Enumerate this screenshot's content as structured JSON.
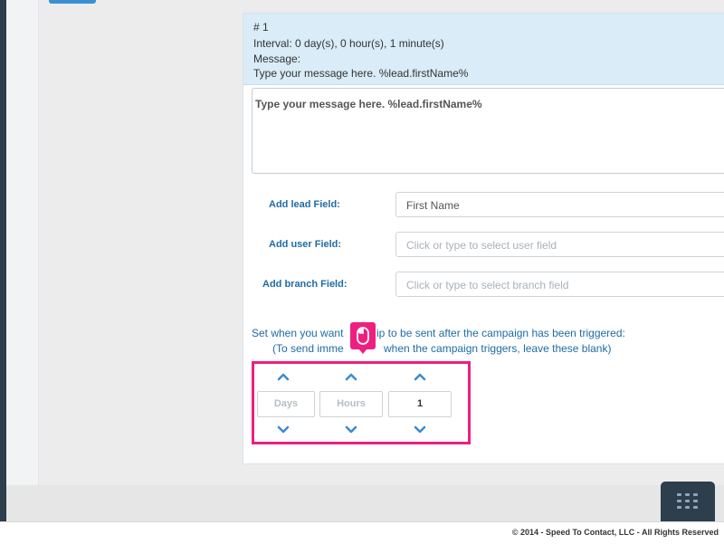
{
  "step": {
    "number": "# 1",
    "interval": "Interval: 0 day(s), 0 hour(s), 1 minute(s)",
    "message_label": "Message:",
    "message_preview": "Type your message here. %lead.firstName%"
  },
  "message_editor": {
    "text": "Type your message here. %lead.firstName%"
  },
  "fields": {
    "lead": {
      "label": "Add lead Field:",
      "value": "First Name"
    },
    "user": {
      "label": "Add user Field:",
      "placeholder": "Click or type to select user field"
    },
    "branch": {
      "label": "Add branch Field:",
      "placeholder": "Click or type to select branch field"
    }
  },
  "schedule": {
    "line1_part1": "Set when you want",
    "line1_part2": "ip to be sent after the campaign has been triggered:",
    "line2_part1": "(To send imme",
    "line2_part2": "when the campaign triggers, leave these blank)"
  },
  "spinners": {
    "days": {
      "placeholder": "Days",
      "value": ""
    },
    "hours": {
      "placeholder": "Hours",
      "value": ""
    },
    "minutes": {
      "value": "1"
    }
  },
  "footer": {
    "copyright": "© 2014 - Speed To Contact, LLC - All Rights Reserved"
  },
  "icons": {
    "spinner_up": "chevron-up-icon",
    "spinner_down": "chevron-down-icon",
    "cursor": "mouse-icon",
    "apps": "grid-icon"
  },
  "colors": {
    "highlight": "#ee1f7f",
    "label_blue": "#1f6ba5",
    "header_bg": "#d9ecf7",
    "nav_dark": "#2d3e4c"
  }
}
